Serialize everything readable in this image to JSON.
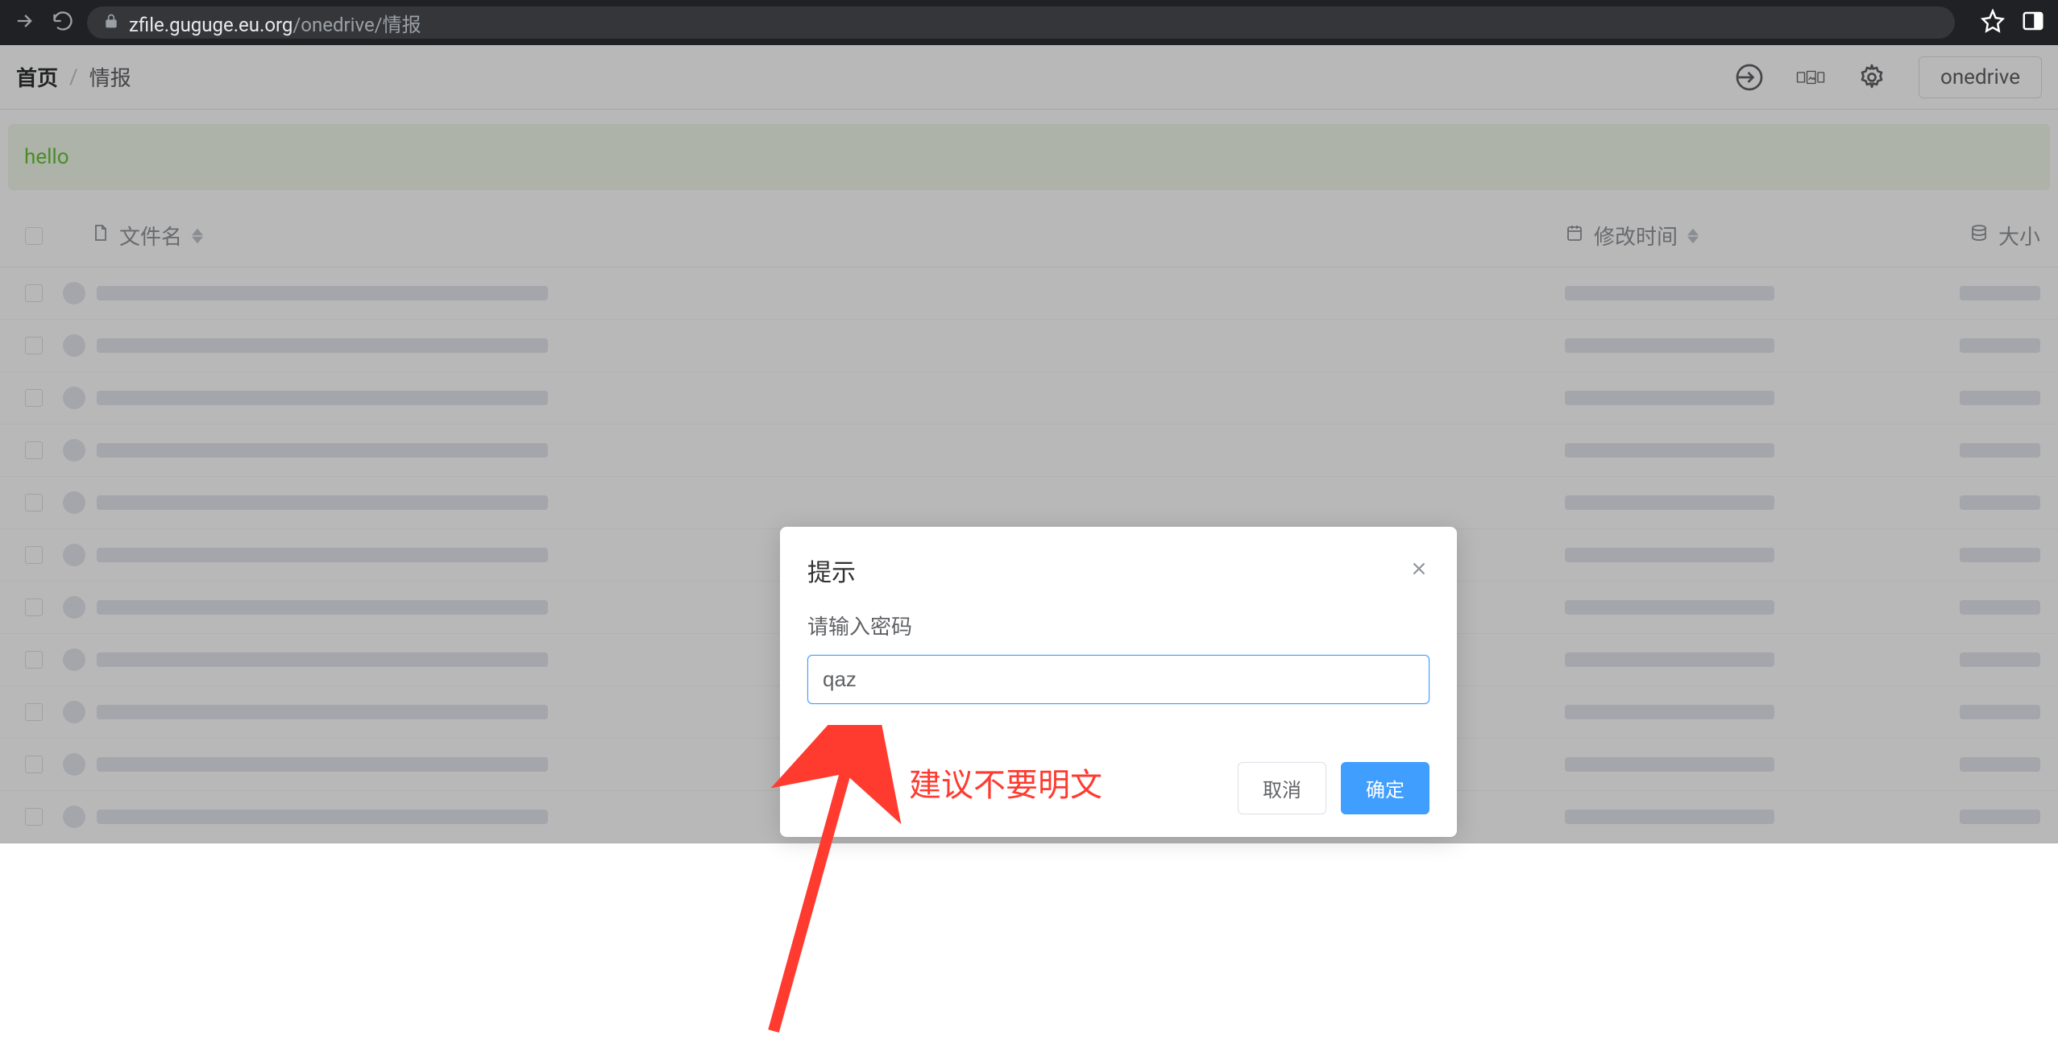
{
  "browser": {
    "url_host": "zfile.guguge.eu.org",
    "url_path": "/onedrive/情报"
  },
  "breadcrumb": {
    "home": "首页",
    "separator": "/",
    "current": "情报"
  },
  "drive_selector": "onedrive",
  "banner": "hello",
  "columns": {
    "filename": "文件名",
    "modified": "修改时间",
    "size": "大小"
  },
  "row_count": 11,
  "modal": {
    "title": "提示",
    "label": "请输入密码",
    "value": "qaz",
    "cancel": "取消",
    "confirm": "确定"
  },
  "annotation": "建议不要明文"
}
